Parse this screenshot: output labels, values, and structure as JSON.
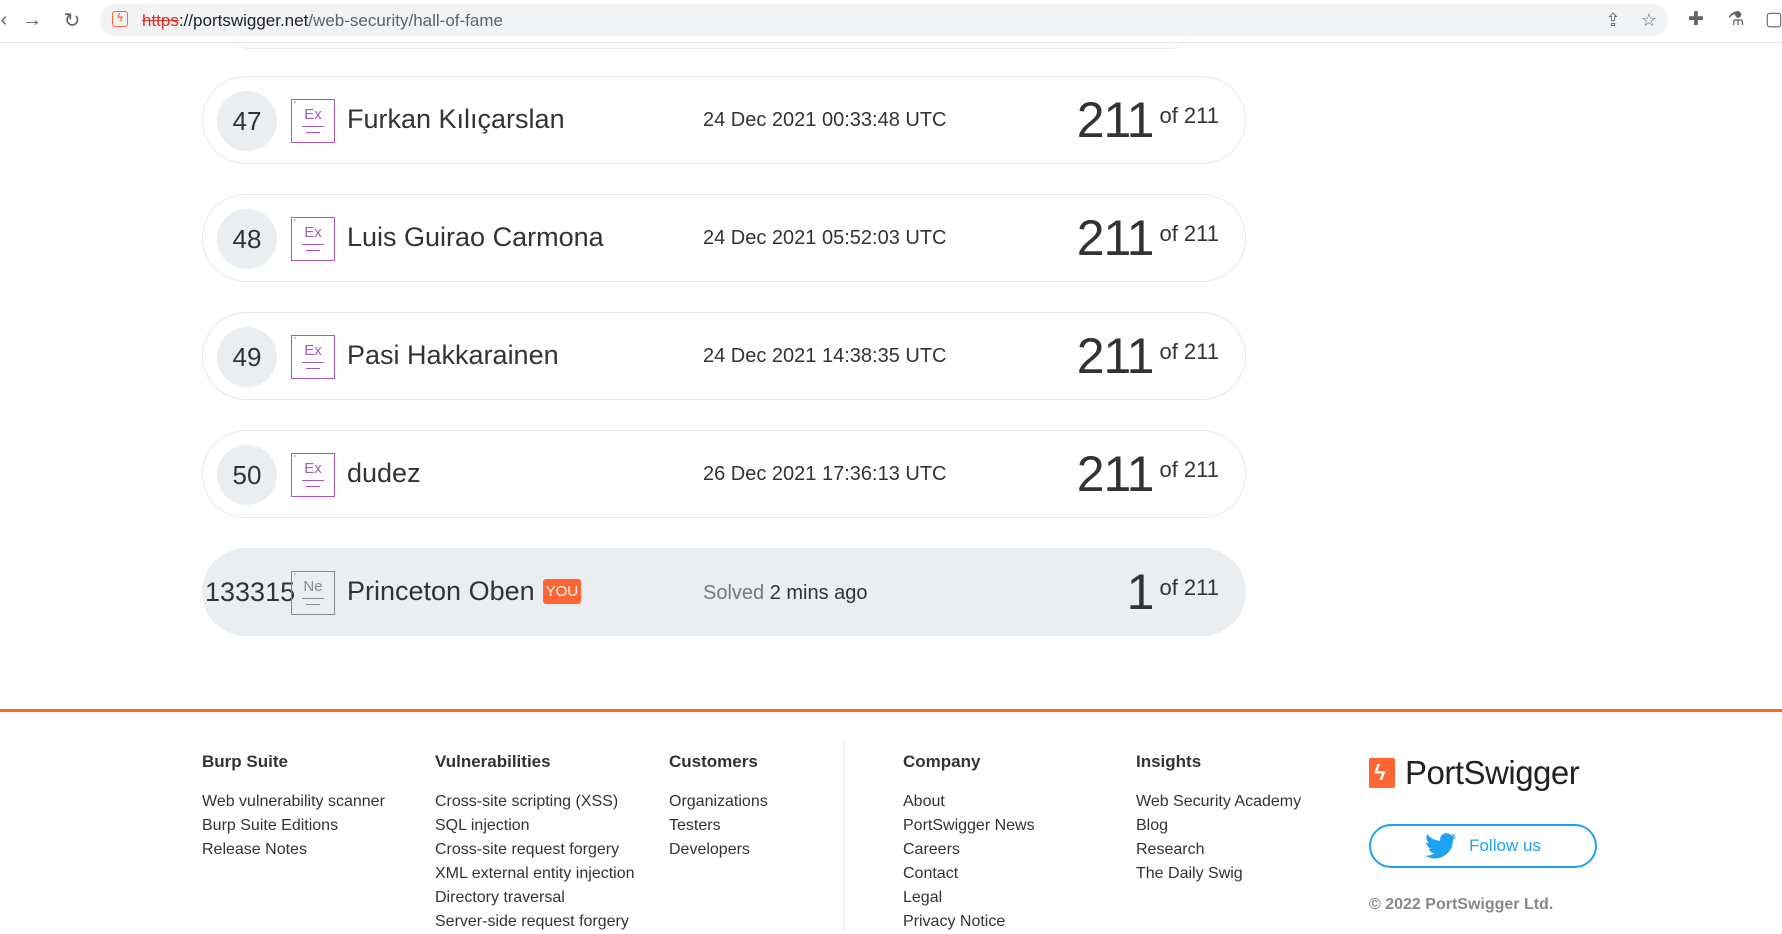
{
  "browser": {
    "url_protocol": "https",
    "url_host": "://portswigger.net",
    "url_path": "/web-security/hall-of-fame",
    "site_icon": "ϟ"
  },
  "leaderboard": {
    "rows": [
      {
        "rank": "47",
        "badge": "Ex",
        "name": "Furkan Kılıçarslan",
        "date": "24 Dec 2021 00:33:48 UTC",
        "score": "211",
        "of": "of 211"
      },
      {
        "rank": "48",
        "badge": "Ex",
        "name": "Luis Guirao Carmona",
        "date": "24 Dec 2021 05:52:03 UTC",
        "score": "211",
        "of": "of 211"
      },
      {
        "rank": "49",
        "badge": "Ex",
        "name": "Pasi Hakkarainen",
        "date": "24 Dec 2021 14:38:35 UTC",
        "score": "211",
        "of": "of 211"
      },
      {
        "rank": "50",
        "badge": "Ex",
        "name": "dudez",
        "date": "26 Dec 2021 17:36:13 UTC",
        "score": "211",
        "of": "of 211"
      }
    ],
    "you_row": {
      "rank": "133315",
      "badge": "Ne",
      "name": "Princeton Oben",
      "you_label": "YOU",
      "solved_prefix": "Solved",
      "solved_time": "2 mins ago",
      "score": "1",
      "of": "of 211"
    }
  },
  "footer": {
    "columns": [
      {
        "heading": "Burp Suite",
        "links": [
          "Web vulnerability scanner",
          "Burp Suite Editions",
          "Release Notes"
        ]
      },
      {
        "heading": "Vulnerabilities",
        "links": [
          "Cross-site scripting (XSS)",
          "SQL injection",
          "Cross-site request forgery",
          "XML external entity injection",
          "Directory traversal",
          "Server-side request forgery"
        ]
      },
      {
        "heading": "Customers",
        "links": [
          "Organizations",
          "Testers",
          "Developers"
        ]
      },
      {
        "heading": "Company",
        "links": [
          "About",
          "PortSwigger News",
          "Careers",
          "Contact",
          "Legal",
          "Privacy Notice"
        ]
      },
      {
        "heading": "Insights",
        "links": [
          "Web Security Academy",
          "Blog",
          "Research",
          "The Daily Swig"
        ]
      }
    ],
    "logo_text": "PortSwigger",
    "follow_label": "Follow us",
    "copyright": "© 2022 PortSwigger Ltd."
  },
  "colors": {
    "accent": "#ff6633",
    "twitter": "#1da1f2",
    "row_highlight": "#eaeef1",
    "badge_expert": "#a75bb6"
  }
}
